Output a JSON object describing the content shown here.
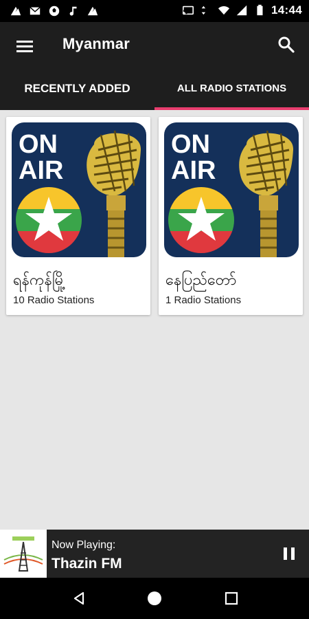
{
  "status_bar": {
    "time": "14:44",
    "left_icons": [
      "app-icon",
      "mail-icon",
      "soccer-icon",
      "music-note-icon",
      "app-icon"
    ],
    "right_icons": [
      "cast-icon",
      "wifi-icon",
      "signal-icon",
      "battery-icon"
    ]
  },
  "app_bar": {
    "title": "Myanmar",
    "menu_icon": "hamburger-menu-icon",
    "search_icon": "search-icon"
  },
  "tabs": [
    {
      "label": "RECENTLY ADDED",
      "selected": false
    },
    {
      "label": "ALL RADIO STATIONS",
      "selected": true
    }
  ],
  "colors": {
    "tab_indicator": "#e83d6e",
    "app_bar": "#1e1e1e",
    "background": "#e6e6e6"
  },
  "cards": [
    {
      "art_text": [
        "ON",
        "AIR"
      ],
      "name": "ရန်ကုန်မြို့",
      "count": "10 Radio Stations"
    },
    {
      "art_text": [
        "ON",
        "AIR"
      ],
      "name": "နေပြည်တော်",
      "count": "1 Radio Stations"
    }
  ],
  "now_playing": {
    "caption": "Now Playing:",
    "station": "Thazin FM",
    "control_icon": "pause-icon"
  },
  "nav_bar": {
    "icons": [
      "back-icon",
      "home-icon",
      "recents-icon"
    ]
  }
}
